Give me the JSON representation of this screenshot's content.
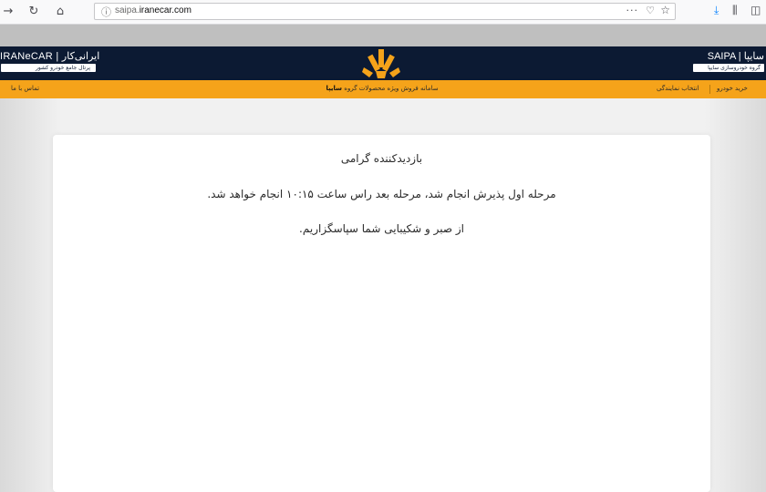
{
  "browser": {
    "url_domain_prefix": "saipa.",
    "url_domain_main": "iranecar.com",
    "back_icon": "back-arrow-icon",
    "forward_icon": "forward-arrow-icon",
    "reload_icon": "reload-icon",
    "home_icon": "home-icon",
    "menu_dots": "···"
  },
  "header": {
    "left_brand": "IRANeCAR | ایرانی‌کار",
    "left_sub": "پرتال جامع خودرو کشور",
    "right_brand": "SAIPA | سایپا",
    "right_sub": "گروه خودروسازی سایپا"
  },
  "nav": {
    "contact": "تماس با ما",
    "center_prefix": "سامانه فروش ویژه محصولات گروه ",
    "center_brand": "سایپا",
    "choose_rep": "انتخاب نمایندگی",
    "buy_car": "خرید خودرو"
  },
  "content": {
    "greeting": "بازدیدکننده گرامی",
    "message1": "مرحله اول پذیرش انجام شد، مرحله بعد راس ساعت ۱۰:۱۵ انجام خواهد شد.",
    "message2": "از صبر و شکیبایی شما سپاسگزاریم."
  },
  "colors": {
    "header_bg": "#0c1a33",
    "accent_orange": "#f5a31a"
  }
}
